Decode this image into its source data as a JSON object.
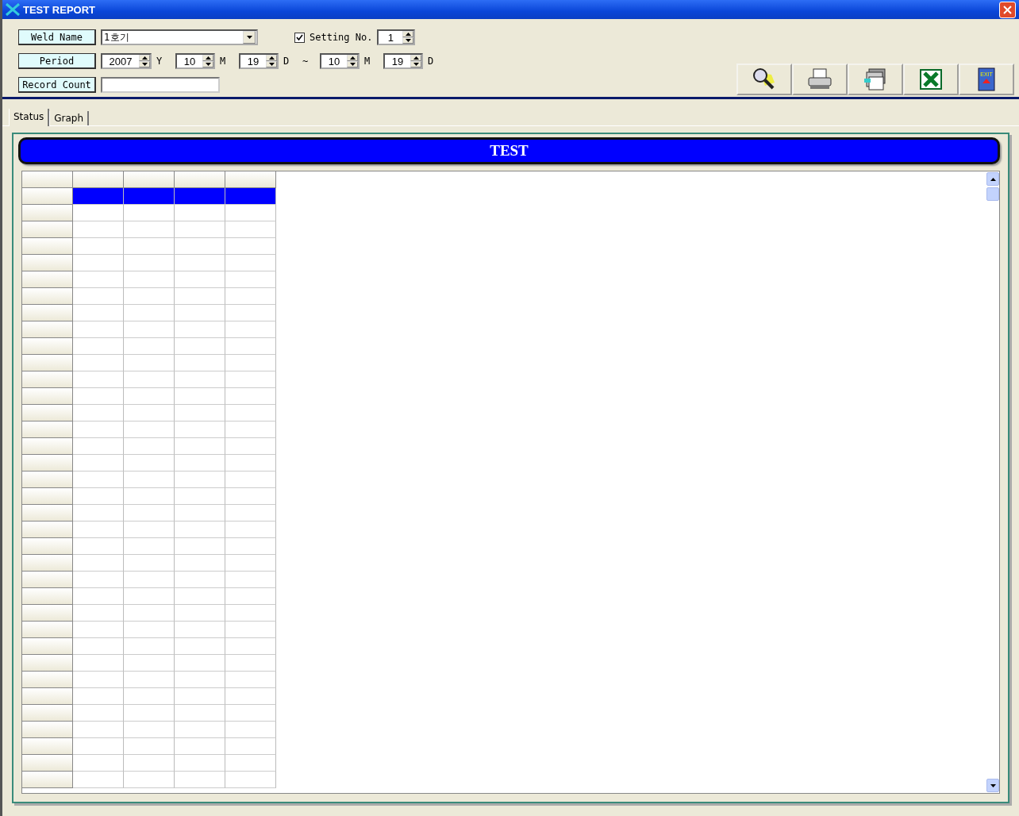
{
  "window": {
    "title": "TEST REPORT"
  },
  "weld_name": {
    "label": "Weld Name",
    "value": "1호기"
  },
  "setting": {
    "checked": true,
    "label": "Setting No.",
    "value": "1"
  },
  "period": {
    "label": "Period",
    "start": [
      {
        "value": "2007",
        "unit": "Y"
      },
      {
        "value": "10",
        "unit": "M"
      },
      {
        "value": "19",
        "unit": "D"
      }
    ],
    "separator": "~",
    "end": [
      {
        "value": "10",
        "unit": "M"
      },
      {
        "value": "19",
        "unit": "D"
      }
    ]
  },
  "record_count": {
    "label": "Record Count"
  },
  "toolbar": [
    {
      "kind": "search"
    },
    {
      "kind": "print"
    },
    {
      "kind": "report"
    },
    {
      "kind": "excel"
    },
    {
      "kind": "exit",
      "text": "EXIT"
    }
  ],
  "tabs": [
    {
      "label": "Status",
      "selected": true
    },
    {
      "label": "Graph",
      "selected": false
    }
  ],
  "banner": {
    "title": "TEST"
  },
  "grid": {
    "rows": [
      {
        "selected": true
      },
      {
        "selected": false
      },
      {
        "selected": false
      },
      {
        "selected": false
      },
      {
        "selected": false
      },
      {
        "selected": false
      },
      {
        "selected": false
      },
      {
        "selected": false
      },
      {
        "selected": false
      },
      {
        "selected": false
      },
      {
        "selected": false
      },
      {
        "selected": false
      },
      {
        "selected": false
      },
      {
        "selected": false
      },
      {
        "selected": false
      },
      {
        "selected": false
      },
      {
        "selected": false
      },
      {
        "selected": false
      },
      {
        "selected": false
      },
      {
        "selected": false
      },
      {
        "selected": false
      },
      {
        "selected": false
      },
      {
        "selected": false
      },
      {
        "selected": false
      },
      {
        "selected": false
      },
      {
        "selected": false
      },
      {
        "selected": false
      },
      {
        "selected": false
      },
      {
        "selected": false
      },
      {
        "selected": false
      },
      {
        "selected": false
      },
      {
        "selected": false
      },
      {
        "selected": false
      },
      {
        "selected": false
      },
      {
        "selected": false
      },
      {
        "selected": false
      }
    ]
  }
}
